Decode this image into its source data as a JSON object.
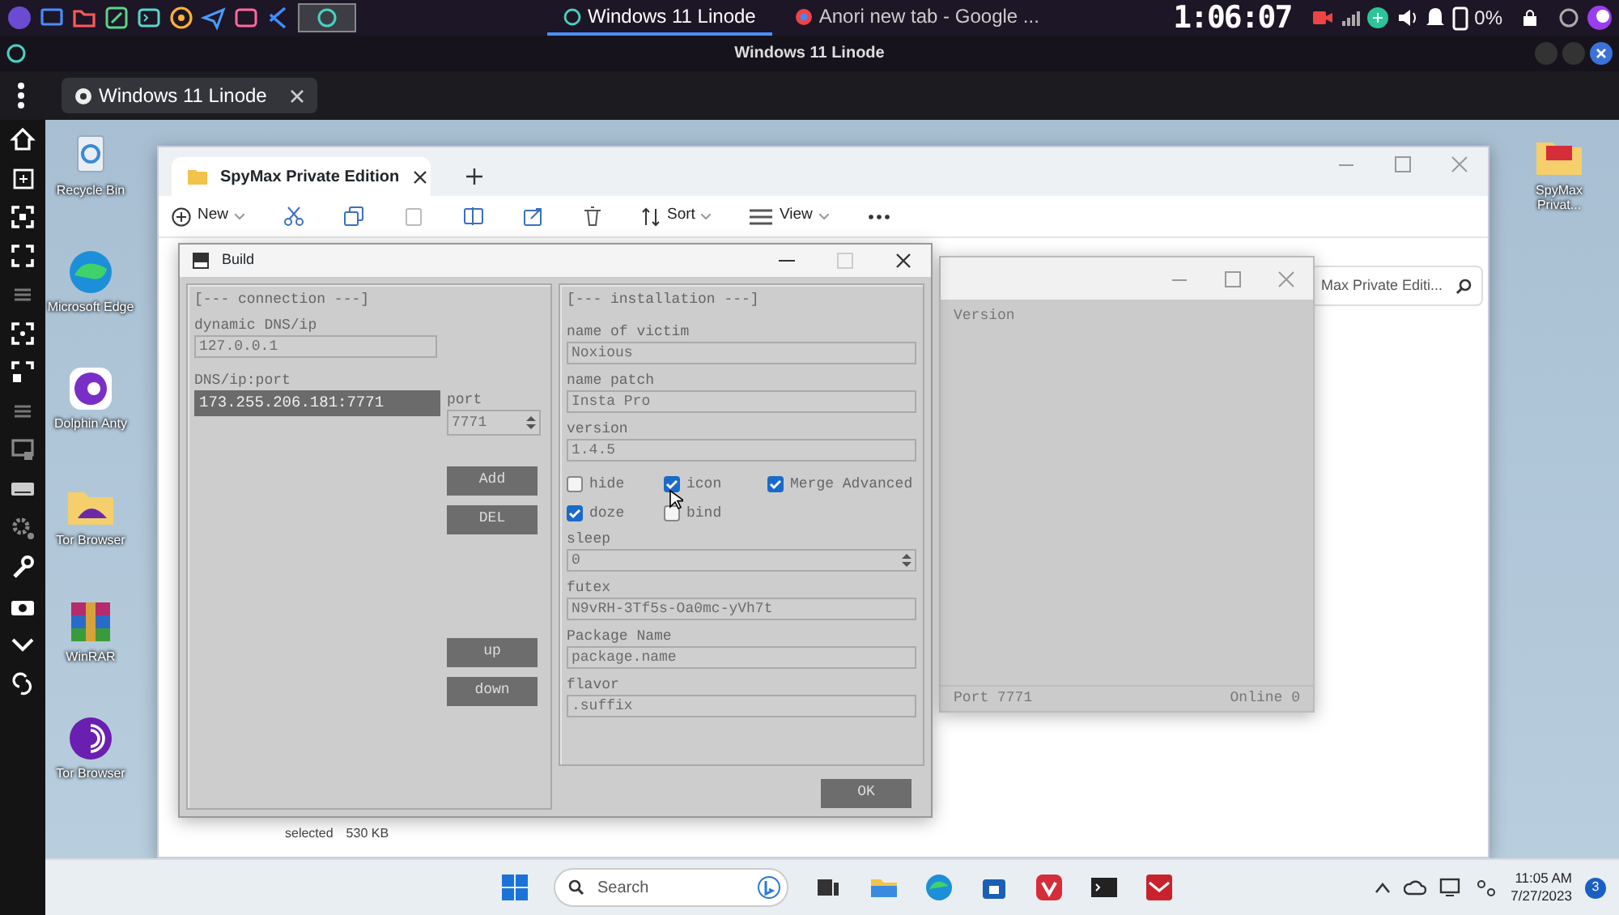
{
  "status_bar": {
    "tabs": [
      {
        "label": "Windows 11 Linode",
        "selected": true
      },
      {
        "label": "Anori new tab - Google ...",
        "selected": false
      }
    ],
    "clock": "1:06:07",
    "battery": "0%"
  },
  "window": {
    "title": "Windows 11 Linode"
  },
  "browser_tabs": [
    {
      "label": "Windows 11 Linode",
      "selected": true
    }
  ],
  "desktop_icons": [
    {
      "label": "Recycle Bin",
      "kind": "recycle"
    },
    {
      "label": "Microsoft Edge",
      "kind": "edge"
    },
    {
      "label": "Dolphin Anty",
      "kind": "dolphin"
    },
    {
      "label": "Tor Browser",
      "kind": "folder"
    },
    {
      "label": "WinRAR",
      "kind": "winrar"
    },
    {
      "label": "Tor Browser",
      "kind": "tor"
    }
  ],
  "desktop_icons_right": [
    {
      "label": "SpyMax Privat...",
      "kind": "spymax"
    }
  ],
  "explorer": {
    "tab": "SpyMax Private Edition",
    "new_label": "New",
    "sort_label": "Sort",
    "view_label": "View",
    "search": "Max Private Editi...",
    "status": [
      "selected",
      "530 KB"
    ]
  },
  "server_window": {
    "column": "Version",
    "port": "Port 7771",
    "online": "Online 0"
  },
  "build_dialog": {
    "title": "Build",
    "connection": {
      "heading": "[--- connection ---]",
      "dns_label": "dynamic DNS/ip",
      "dns_value": "127.0.0.1",
      "list_label": "DNS/ip:port",
      "list": [
        {
          "text": "173.255.206.181:7771",
          "selected": true
        }
      ],
      "port_label": "port",
      "port_value": "7771",
      "buttons": [
        "Add",
        "DEL",
        "up",
        "down"
      ]
    },
    "installation": {
      "heading": "[--- installation ---]",
      "items": [
        {
          "kind": "field",
          "label": "name of victim",
          "value": "Noxious"
        },
        {
          "kind": "field",
          "label": "name patch",
          "value": "Insta Pro"
        },
        {
          "kind": "field",
          "label": "version",
          "value": "1.4.5"
        },
        {
          "kind": "checkboxes",
          "boxes": [
            {
              "label": "hide",
              "checked": false
            },
            {
              "label": "icon",
              "checked": true
            },
            {
              "label": "Merge Advanced",
              "checked": true
            },
            {
              "label": "doze",
              "checked": true
            },
            {
              "label": "bind",
              "checked": false
            }
          ]
        },
        {
          "kind": "spinner",
          "label": "sleep",
          "value": "0"
        },
        {
          "kind": "field",
          "label": "futex",
          "value": "N9vRH-3Tf5s-Oa0mc-yVh7t"
        },
        {
          "kind": "field",
          "label": "Package Name",
          "value": "package.name"
        },
        {
          "kind": "field",
          "label": "flavor",
          "value": ".suffix"
        }
      ]
    },
    "ok": "OK"
  },
  "taskbar": {
    "search_placeholder": "Search",
    "time": "11:05 AM",
    "date": "7/27/2023",
    "notifications": "3"
  }
}
